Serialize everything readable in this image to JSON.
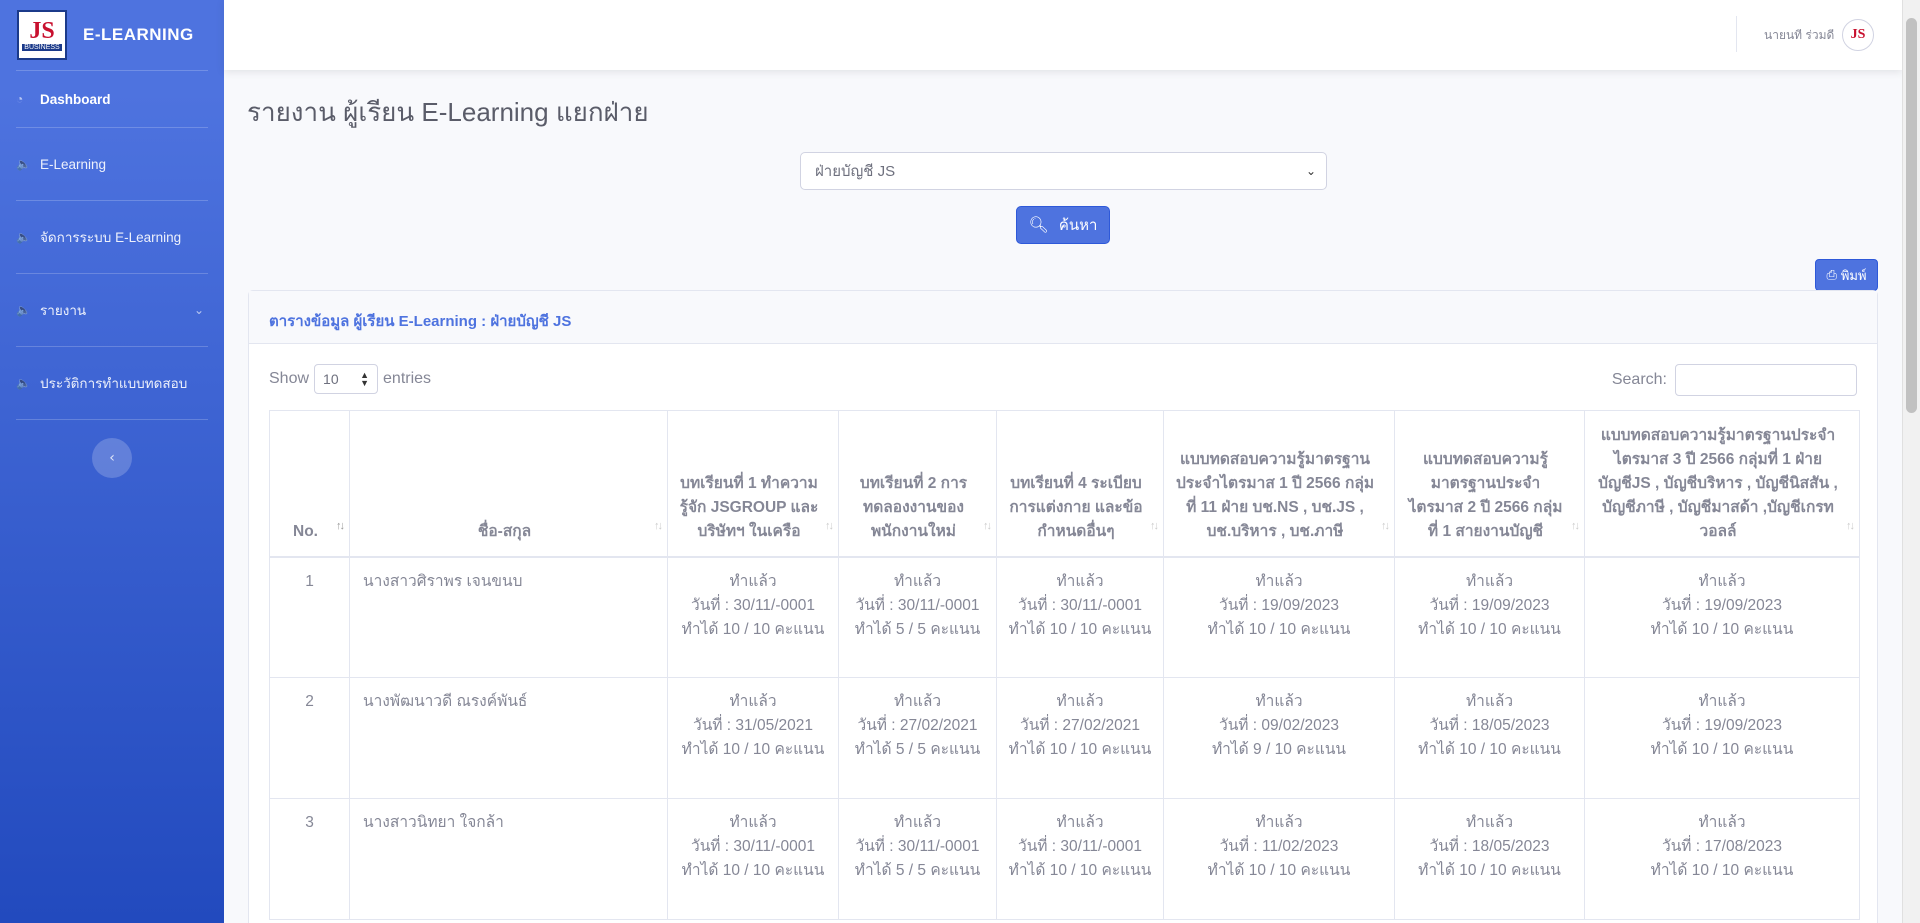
{
  "brand": {
    "logo_text": "JS",
    "logo_sub": "BUSINESS",
    "title": "E-LEARNING"
  },
  "sidebar": {
    "items": [
      {
        "label": "Dashboard"
      },
      {
        "label": "E-Learning"
      },
      {
        "label": "จัดการระบบ E-Learning"
      },
      {
        "label": "รายงาน"
      },
      {
        "label": "ประวัติการทำแบบทดสอบ"
      }
    ]
  },
  "topbar": {
    "user_name": "นายนที ร่วมดี",
    "avatar_text": "JS"
  },
  "page": {
    "title": "รายงาน ผู้เรียน E-Learning แยกฝ่าย",
    "department_selected": "ฝ่ายบัญชี JS",
    "search_label": "ค้นหา",
    "print_label": "พิมพ์"
  },
  "card": {
    "header": "ตารางข้อมูล ผู้เรียน E-Learning : ฝ่ายบัญชี JS",
    "show_label": "Show",
    "entries_value": "10",
    "entries_label": "entries",
    "search_label": "Search:"
  },
  "table": {
    "columns": [
      "No.",
      "ชื่อ-สกุล",
      "บทเรียนที่ 1 ทำความรู้จัก JSGROUP และบริษัทฯ ในเครือ",
      "บทเรียนที่ 2 การทดลองงานของพนักงานใหม่",
      "บทเรียนที่ 4 ระเบียบการแต่งกาย และข้อกำหนดอื่นๆ",
      "แบบทดสอบความรู้มาตรฐานประจำไตรมาส 1 ปี 2566 กลุ่มที่ 11 ฝ่าย บช.NS , บช.JS , บช.บริหาร , บช.ภาษี",
      "แบบทดสอบความรู้มาตรฐานประจำไตรมาส 2 ปี 2566 กลุ่มที่ 1 สายงานบัญชี",
      "แบบทดสอบความรู้มาตรฐานประจำไตรมาส 3 ปี 2566 กลุ่มที่ 1 ฝ่าย บัญชีJS , บัญชีบริหาร , บัญชีนิสสัน , บัญชีภาษี , บัญชีมาสด้า ,บัญชีเกรทวอลล์"
    ],
    "rows": [
      {
        "no": "1",
        "name": "นางสาวศิราพร เจนขนบ",
        "cells": [
          {
            "status": "ทำแล้ว",
            "date": "วันที่ : 30/11/-0001",
            "score": "ทำได้ 10 / 10 คะแนน"
          },
          {
            "status": "ทำแล้ว",
            "date": "วันที่ : 30/11/-0001",
            "score": "ทำได้ 5 / 5 คะแนน"
          },
          {
            "status": "ทำแล้ว",
            "date": "วันที่ : 30/11/-0001",
            "score": "ทำได้ 10 / 10 คะแนน"
          },
          {
            "status": "ทำแล้ว",
            "date": "วันที่ : 19/09/2023",
            "score": "ทำได้ 10 / 10 คะแนน"
          },
          {
            "status": "ทำแล้ว",
            "date": "วันที่ : 19/09/2023",
            "score": "ทำได้ 10 / 10 คะแนน"
          },
          {
            "status": "ทำแล้ว",
            "date": "วันที่ : 19/09/2023",
            "score": "ทำได้ 10 / 10 คะแนน"
          }
        ]
      },
      {
        "no": "2",
        "name": "นางพัฒนาวดี ณรงค์พันธ์",
        "cells": [
          {
            "status": "ทำแล้ว",
            "date": "วันที่ : 31/05/2021",
            "score": "ทำได้ 10 / 10 คะแนน"
          },
          {
            "status": "ทำแล้ว",
            "date": "วันที่ : 27/02/2021",
            "score": "ทำได้ 5 / 5 คะแนน"
          },
          {
            "status": "ทำแล้ว",
            "date": "วันที่ : 27/02/2021",
            "score": "ทำได้ 10 / 10 คะแนน"
          },
          {
            "status": "ทำแล้ว",
            "date": "วันที่ : 09/02/2023",
            "score": "ทำได้ 9 / 10 คะแนน"
          },
          {
            "status": "ทำแล้ว",
            "date": "วันที่ : 18/05/2023",
            "score": "ทำได้ 10 / 10 คะแนน"
          },
          {
            "status": "ทำแล้ว",
            "date": "วันที่ : 19/09/2023",
            "score": "ทำได้ 10 / 10 คะแนน"
          }
        ]
      },
      {
        "no": "3",
        "name": "นางสาวนิทยา ใจกล้า",
        "cells": [
          {
            "status": "ทำแล้ว",
            "date": "วันที่ : 30/11/-0001",
            "score": "ทำได้ 10 / 10 คะแนน"
          },
          {
            "status": "ทำแล้ว",
            "date": "วันที่ : 30/11/-0001",
            "score": "ทำได้ 5 / 5 คะแนน"
          },
          {
            "status": "ทำแล้ว",
            "date": "วันที่ : 30/11/-0001",
            "score": "ทำได้ 10 / 10 คะแนน"
          },
          {
            "status": "ทำแล้ว",
            "date": "วันที่ : 11/02/2023",
            "score": "ทำได้ 10 / 10 คะแนน"
          },
          {
            "status": "ทำแล้ว",
            "date": "วันที่ : 18/05/2023",
            "score": "ทำได้ 10 / 10 คะแนน"
          },
          {
            "status": "ทำแล้ว",
            "date": "วันที่ : 17/08/2023",
            "score": "ทำได้ 10 / 10 คะแนน"
          }
        ]
      }
    ]
  }
}
